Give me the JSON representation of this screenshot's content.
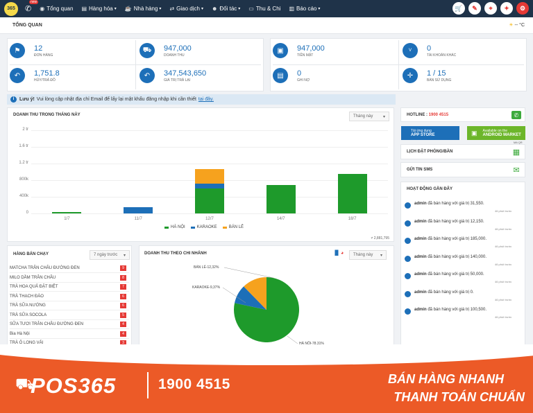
{
  "topbar": {
    "phone_badge": "new",
    "nav": [
      {
        "label": "Tổng quan",
        "icon": "eye-icon",
        "caret": false
      },
      {
        "label": "Hàng hóa",
        "icon": "box-icon",
        "caret": true
      },
      {
        "label": "Nhà hàng",
        "icon": "restaurant-icon",
        "caret": true
      },
      {
        "label": "Giao dịch",
        "icon": "exchange-icon",
        "caret": true
      },
      {
        "label": "Đối tác",
        "icon": "users-icon",
        "caret": true
      },
      {
        "label": "Thu & Chi",
        "icon": "wallet-icon",
        "caret": false
      },
      {
        "label": "Báo cáo",
        "icon": "chart-icon",
        "caret": true
      }
    ]
  },
  "page": {
    "title": "TỔNG QUAN",
    "weather": "-- °C"
  },
  "stats": [
    {
      "value": "12",
      "label": "Đơn hàng",
      "icon": "tag-icon"
    },
    {
      "value": "947,000",
      "label": "Doanh thu",
      "icon": "cart-icon"
    },
    {
      "value": "947,000",
      "label": "Tiền mặt",
      "icon": "cash-icon"
    },
    {
      "value": "0",
      "label": "Tài khoản khác",
      "icon": "visa-icon"
    },
    {
      "value": "1,751.8",
      "label": "Hủy/Trả đồ",
      "icon": "undo-icon"
    },
    {
      "value": "347,543,650",
      "label": "Giá trị trả lại",
      "icon": "undo-icon"
    },
    {
      "value": "0",
      "label": "Ghi nợ",
      "icon": "id-card-icon"
    },
    {
      "value": "1 / 15",
      "label": "Bàn sử dụng",
      "icon": "target-icon"
    }
  ],
  "notice": {
    "bold": "Lưu ý!",
    "text": "Vui lòng cập nhật địa chỉ Email để lấy lại mật khẩu đăng nhập khi cần thiết",
    "link": "tại đây."
  },
  "revenue_month": {
    "title": "DOANH THU TRONG THÁNG NÀY",
    "filter": "Tháng này",
    "total": "≠ 2,881,795",
    "y_ticks": [
      "2 tr",
      "1.6 tr",
      "1.2 tr",
      "800k",
      "400k",
      "0"
    ]
  },
  "chart_data": [
    {
      "type": "bar",
      "title": "DOANH THU TRONG THÁNG NÀY",
      "categories": [
        "1/7",
        "11/7",
        "12/7",
        "14/7",
        "18/7"
      ],
      "series": [
        {
          "name": "HÀ NỘI",
          "color": "#1e9a2b",
          "values": [
            30000,
            0,
            600000,
            690000,
            950000
          ]
        },
        {
          "name": "KARAOKE",
          "color": "#1d6fb8",
          "values": [
            0,
            150000,
            120000,
            0,
            0
          ]
        },
        {
          "name": "BÁN LẺ",
          "color": "#f6a21e",
          "values": [
            0,
            0,
            340000,
            0,
            0
          ]
        }
      ],
      "stacked": true,
      "ylim": [
        0,
        2000000
      ]
    },
    {
      "type": "pie",
      "title": "DOANH THU THEO CHI NHÁNH",
      "labels": [
        "HÀ NỘI",
        "KARAOKE",
        "BÁN LẺ"
      ],
      "values": [
        78.31,
        9.37,
        12.32
      ],
      "colors": [
        "#1e9a2b",
        "#1d6fb8",
        "#f6a21e"
      ],
      "slice_labels": [
        "HÀ NỘI-78,31%",
        "KARAOKE-9,37%",
        "BÁN LẺ-12,32%"
      ]
    }
  ],
  "top_products": {
    "title": "HÀNG BÁN CHẠY",
    "filter": "7 ngày trước",
    "items": [
      {
        "name": "MATCHA TRÂN CHÂU ĐƯỜNG ĐEN",
        "count": "9"
      },
      {
        "name": "MILO DẦM TRÂN CHÂU",
        "count": "8"
      },
      {
        "name": "TRÀ HOA QUẢ ĐẶT BIỆT",
        "count": "7"
      },
      {
        "name": "TRÀ THẠCH ĐÀO",
        "count": "6"
      },
      {
        "name": "TRÀ SỮA NƯỚNG",
        "count": "6"
      },
      {
        "name": "TRÀ SỮA SOCOLA",
        "count": "5"
      },
      {
        "name": "SỮA TƯƠI TRÂN CHÂU ĐƯỜNG ĐEN",
        "count": "4"
      },
      {
        "name": "Bia Hà Nội",
        "count": "4"
      },
      {
        "name": "TRÀ Ô LONG VẢI",
        "count": "3"
      }
    ]
  },
  "branch_revenue": {
    "title": "DOANH THU THEO CHI NHÁNH",
    "filter": "Tháng này"
  },
  "right": {
    "hotline_label": "HOTLINE :",
    "hotline_number": "1900 4515",
    "app_store_small": "Tải ứng dụng",
    "app_store": "APP STORE",
    "android_small": "Available on the",
    "android": "ANDROID MARKET",
    "qr": "Mã QR",
    "booking": "LỊCH ĐẶT PHÒNG/BÀN",
    "sms": "GỬI TIN SMS",
    "activity_title": "HOẠT ĐỘNG GẦN ĐÂY",
    "activities": [
      {
        "user": "admin",
        "text": "đã bán hàng với giá trị 31,550.",
        "time": "46 phút trước"
      },
      {
        "user": "admin",
        "text": "đã bán hàng với giá trị 12,150.",
        "time": "46 phút trước"
      },
      {
        "user": "admin",
        "text": "đã bán hàng với giá trị 185,000.",
        "time": "46 phút trước"
      },
      {
        "user": "admin",
        "text": "đã bán hàng với giá trị 140,000.",
        "time": "46 phút trước"
      },
      {
        "user": "admin",
        "text": "đã bán hàng với giá trị 50,000.",
        "time": "46 phút trước"
      },
      {
        "user": "admin",
        "text": "đã bán hàng với giá trị 0.",
        "time": "46 phút trước"
      },
      {
        "user": "admin",
        "text": "đã bán hàng với giá trị 100,500.",
        "time": "46 phút trước"
      }
    ]
  },
  "banner": {
    "brand": "POS365",
    "hotline": "1900 4515",
    "slogan1": "BÁN HÀNG NHANH",
    "slogan2": "THANH TOÁN CHUẨN"
  }
}
